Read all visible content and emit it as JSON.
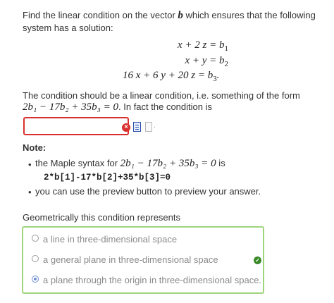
{
  "question": {
    "intro_a": "Find the linear condition on the vector ",
    "intro_vec": "b",
    "intro_b": " which ensures that the following",
    "intro_line2": "system has a solution:",
    "equations": [
      {
        "lhs": "x + 2 z = ",
        "rhs": "b",
        "sub": "1",
        "end": ""
      },
      {
        "lhs": "x + y = ",
        "rhs": "b",
        "sub": "2",
        "end": ""
      },
      {
        "lhs": "16 x + 6 y + 20 z = ",
        "rhs": "b",
        "sub": "3",
        "end": "."
      }
    ],
    "condition_line1": "The condition should be a linear condition, i.e. something of the form",
    "condition_math": "2b₁ − 17b₂ + 35b₃ = 0",
    "condition_line2_tail": ". In fact the condition is"
  },
  "answer": {
    "value": "",
    "placeholder": ""
  },
  "note": {
    "title": "Note:",
    "bullet1_prefix": "the Maple syntax for ",
    "bullet1_math": "2b₁ − 17b₂ + 35b₃ = 0",
    "bullet1_suffix": " is",
    "maple_syntax": "2*b[1]-17*b[2]+35*b[3]=0",
    "bullet2": "you can use the preview button to preview your answer."
  },
  "geometry": {
    "prompt": "Geometrically this condition represents",
    "options": [
      {
        "label": "a line in three-dimensional space",
        "selected": false
      },
      {
        "label": "a general plane in three-dimensional space",
        "selected": false
      },
      {
        "label": "a plane through the origin in three-dimensional space.",
        "selected": true
      }
    ],
    "status": "correct"
  },
  "colors": {
    "error": "#d9302e",
    "correct_border": "#9ed57c",
    "correct_check": "#3a8a2a",
    "radio_selected": "#6e8fd6"
  },
  "icons": [
    "error-icon",
    "preview-icon",
    "document-icon",
    "checkmark-icon"
  ]
}
